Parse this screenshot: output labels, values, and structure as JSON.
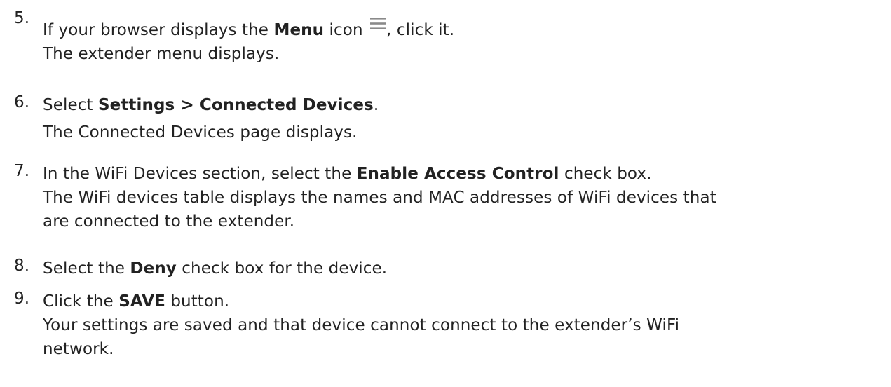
{
  "steps": [
    {
      "number": "5.",
      "line1": {
        "pre": "If your browser displays the ",
        "bold": "Menu",
        "mid": " icon ",
        "icon": "hamburger-menu-icon",
        "post": ", click it."
      },
      "line2": "The extender menu displays."
    },
    {
      "number": "6.",
      "line1": {
        "pre": "Select ",
        "bold": "Settings > Connected Devices",
        "post": "."
      },
      "line2": "The Connected Devices page displays."
    },
    {
      "number": "7.",
      "line1": {
        "pre": "In the WiFi Devices section, select the ",
        "bold": "Enable Access Control",
        "post": " check box."
      },
      "line2": "The WiFi devices table displays the names and MAC addresses of WiFi devices that",
      "line3": "are connected to the extender."
    },
    {
      "number": "8.",
      "line1": {
        "pre": "Select the ",
        "bold": "Deny",
        "post": " check box for the device."
      }
    },
    {
      "number": "9.",
      "line1": {
        "pre": "Click the ",
        "bold": "SAVE",
        "post": " button."
      },
      "line2": "Your settings are saved and that device cannot connect to the extender’s WiFi",
      "line3": "network."
    }
  ],
  "icon_color": "#8a8a8a"
}
